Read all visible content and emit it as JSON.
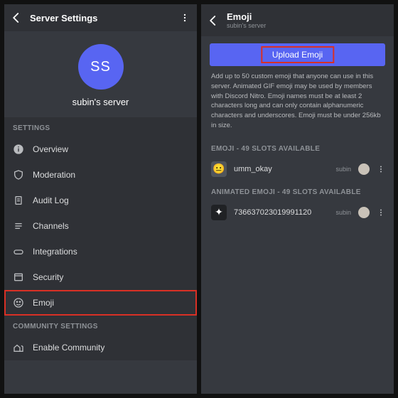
{
  "left": {
    "header": {
      "title": "Server Settings"
    },
    "avatar_initials": "SS",
    "server_name": "subin's server",
    "section_settings": "SETTINGS",
    "section_community": "COMMUNITY SETTINGS",
    "items": {
      "overview": "Overview",
      "moderation": "Moderation",
      "auditlog": "Audit Log",
      "channels": "Channels",
      "integrations": "Integrations",
      "security": "Security",
      "emoji": "Emoji",
      "enable_community": "Enable Community"
    }
  },
  "right": {
    "header": {
      "title": "Emoji",
      "subtitle": "subin's server"
    },
    "upload_label": "Upload Emoji",
    "description": "Add up to 50 custom emoji that anyone can use in this server. Animated GIF emoji may be used by members with Discord Nitro. Emoji names must be at least 2 characters long and can only contain alphanumeric characters and underscores. Emoji must be under 256kb in size.",
    "emoji_slots_label": "EMOJI - 49 SLOTS AVAILABLE",
    "animated_slots_label": "ANIMATED EMOJI - 49 SLOTS AVAILABLE",
    "emoji1": {
      "name": "umm_okay",
      "owner": "subin"
    },
    "emoji2": {
      "name": "736637023019991120",
      "owner": "subin"
    }
  }
}
